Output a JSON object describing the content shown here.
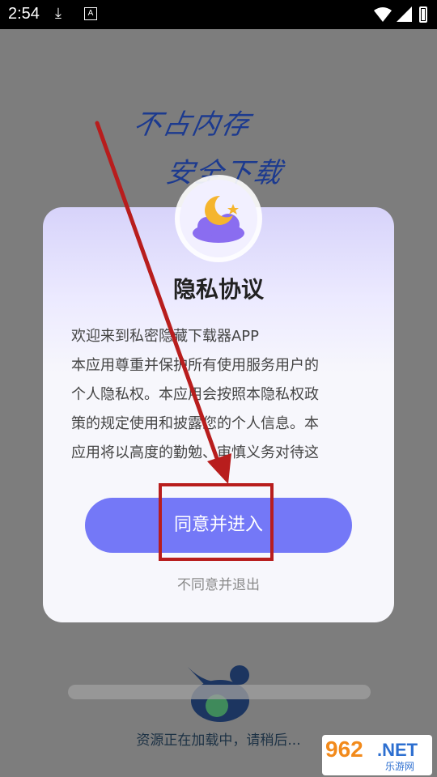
{
  "status_bar": {
    "time": "2:54",
    "a_badge": "A"
  },
  "slogan": {
    "line1": "不占内存",
    "line2": "安全下载"
  },
  "dialog": {
    "title": "隐私协议",
    "body_lines": [
      "欢迎来到私密隐藏下载器APP",
      "本应用尊重并保护所有使用服务用户的",
      "个人隐私权。本应用会按照本隐私权政",
      "策的规定使用和披露您的个人信息。本",
      "应用将以高度的勤勉、审慎义务对待这"
    ],
    "agree_label": "同意并进入",
    "decline_label": "不同意并退出"
  },
  "loading": {
    "text": "资源正在加载中，请稍后..."
  },
  "watermark": {
    "num": "962",
    "net": ".NET",
    "cn": "乐游网"
  },
  "colors": {
    "accent": "#7478f7",
    "annotation": "#b81d1d",
    "slogan": "#1c3a8f"
  }
}
